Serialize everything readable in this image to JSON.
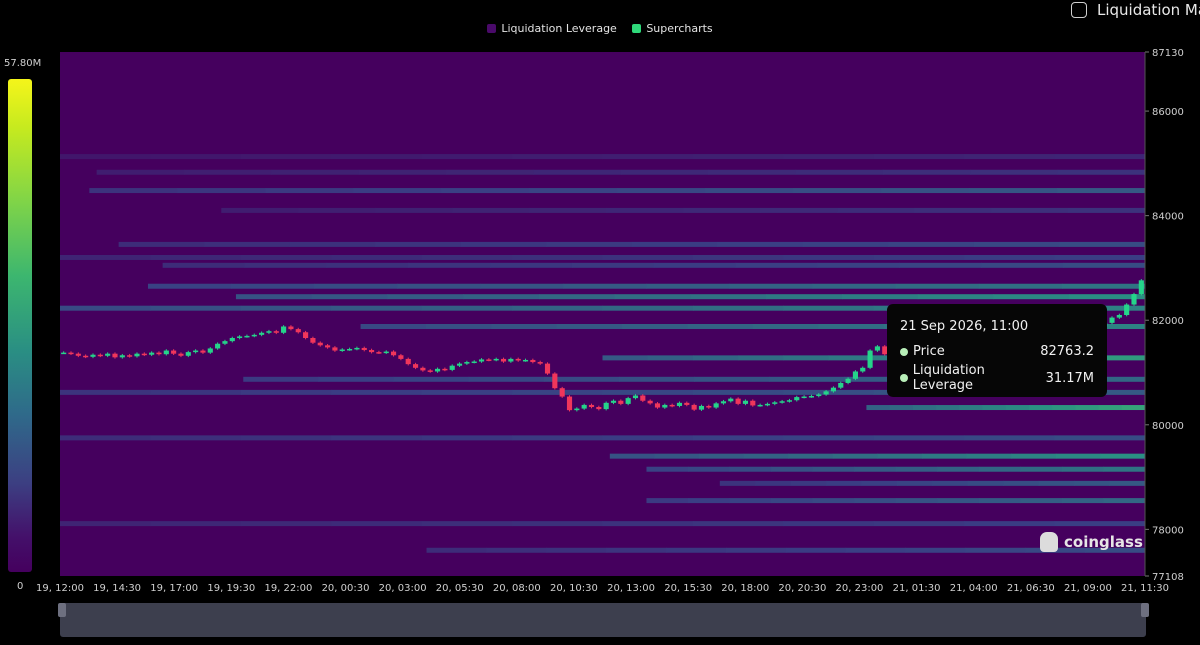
{
  "legend": {
    "items": [
      {
        "label": "Liquidation Leverage",
        "color": "#4a0a6a"
      },
      {
        "label": "Supercharts",
        "color": "#2fd97a"
      }
    ]
  },
  "toggle": {
    "label": "Liquidation Map",
    "checked": false
  },
  "color_scale": {
    "max_label": "57.80M",
    "min_label": "0"
  },
  "tooltip": {
    "date": "21 Sep 2026, 11:00",
    "price_label": "Price",
    "price_value": "82763.2",
    "leverage_label": "Liquidation Leverage",
    "leverage_value": "31.17M"
  },
  "watermark": "coinglass",
  "chart_data": {
    "type": "heatmap",
    "y_axis": {
      "min": 77108,
      "max": 87130,
      "ticks": [
        "87130",
        "86000",
        "84000",
        "82000",
        "80000",
        "78000",
        "77108"
      ]
    },
    "x_axis": {
      "ticks": [
        "19, 12:00",
        "19, 14:30",
        "19, 17:00",
        "19, 19:30",
        "19, 22:00",
        "20, 00:30",
        "20, 03:00",
        "20, 05:30",
        "20, 08:00",
        "20, 10:30",
        "20, 13:00",
        "20, 15:30",
        "20, 18:00",
        "20, 20:30",
        "20, 23:00",
        "21, 01:30",
        "21, 04:00",
        "21, 06:30",
        "21, 09:00",
        "21, 11:30"
      ]
    },
    "colors": {
      "background": "#45005e",
      "low": "#3a3e84",
      "mid": "#2a8f83",
      "high": "#49c16a",
      "peak": "#e9f01d"
    },
    "liquidation_bands": [
      {
        "price": 85130,
        "start_step": 0,
        "level": 0.15
      },
      {
        "price": 84830,
        "start_step": 5,
        "level": 0.2
      },
      {
        "price": 84480,
        "start_step": 4,
        "level": 0.35
      },
      {
        "price": 84100,
        "start_step": 22,
        "level": 0.2
      },
      {
        "price": 83450,
        "start_step": 8,
        "level": 0.3
      },
      {
        "price": 83200,
        "start_step": 0,
        "level": 0.25
      },
      {
        "price": 83050,
        "start_step": 14,
        "level": 0.3
      },
      {
        "price": 82650,
        "start_step": 12,
        "level": 0.45
      },
      {
        "price": 82450,
        "start_step": 24,
        "level": 0.55
      },
      {
        "price": 82230,
        "start_step": 0,
        "level": 0.5
      },
      {
        "price": 81880,
        "start_step": 41,
        "level": 0.5
      },
      {
        "price": 81280,
        "start_step": 74,
        "level": 0.6
      },
      {
        "price": 80870,
        "start_step": 25,
        "level": 0.4
      },
      {
        "price": 80620,
        "start_step": 0,
        "level": 0.35
      },
      {
        "price": 80330,
        "start_step": 110,
        "level": 0.65
      },
      {
        "price": 79750,
        "start_step": 0,
        "level": 0.3
      },
      {
        "price": 79400,
        "start_step": 75,
        "level": 0.55
      },
      {
        "price": 79150,
        "start_step": 80,
        "level": 0.45
      },
      {
        "price": 78880,
        "start_step": 90,
        "level": 0.35
      },
      {
        "price": 78550,
        "start_step": 80,
        "level": 0.4
      },
      {
        "price": 78110,
        "start_step": 0,
        "level": 0.25
      },
      {
        "price": 77600,
        "start_step": 50,
        "level": 0.3
      }
    ],
    "price_series": [
      81380,
      81360,
      81320,
      81300,
      81340,
      81320,
      81360,
      81290,
      81330,
      81310,
      81360,
      81340,
      81380,
      81350,
      81420,
      81360,
      81320,
      81390,
      81420,
      81380,
      81460,
      81550,
      81600,
      81660,
      81690,
      81700,
      81720,
      81760,
      81790,
      81760,
      81880,
      81830,
      81770,
      81660,
      81570,
      81520,
      81480,
      81420,
      81440,
      81450,
      81470,
      81430,
      81390,
      81380,
      81400,
      81330,
      81260,
      81160,
      81090,
      81040,
      81020,
      81070,
      81050,
      81130,
      81170,
      81200,
      81210,
      81250,
      81240,
      81260,
      81210,
      81260,
      81230,
      81240,
      81200,
      81170,
      80980,
      80700,
      80540,
      80280,
      80310,
      80380,
      80340,
      80300,
      80420,
      80460,
      80400,
      80510,
      80560,
      80460,
      80410,
      80330,
      80380,
      80360,
      80420,
      80380,
      80290,
      80360,
      80330,
      80410,
      80450,
      80500,
      80400,
      80460,
      80370,
      80380,
      80400,
      80430,
      80450,
      80470,
      80530,
      80540,
      80550,
      80580,
      80640,
      80710,
      80800,
      80880,
      81020,
      81090,
      81420,
      81500,
      81350,
      81280,
      81350,
      81320,
      81280,
      81180,
      81220,
      81160,
      81160,
      81140,
      81110,
      81060,
      81120,
      81100,
      81120,
      80950,
      80840,
      80860,
      80900,
      80880,
      81000,
      81080,
      81100,
      81180,
      81260,
      81320,
      81430,
      81550,
      81680,
      81880,
      81950,
      82050,
      82100,
      82300,
      82500,
      82763
    ]
  }
}
